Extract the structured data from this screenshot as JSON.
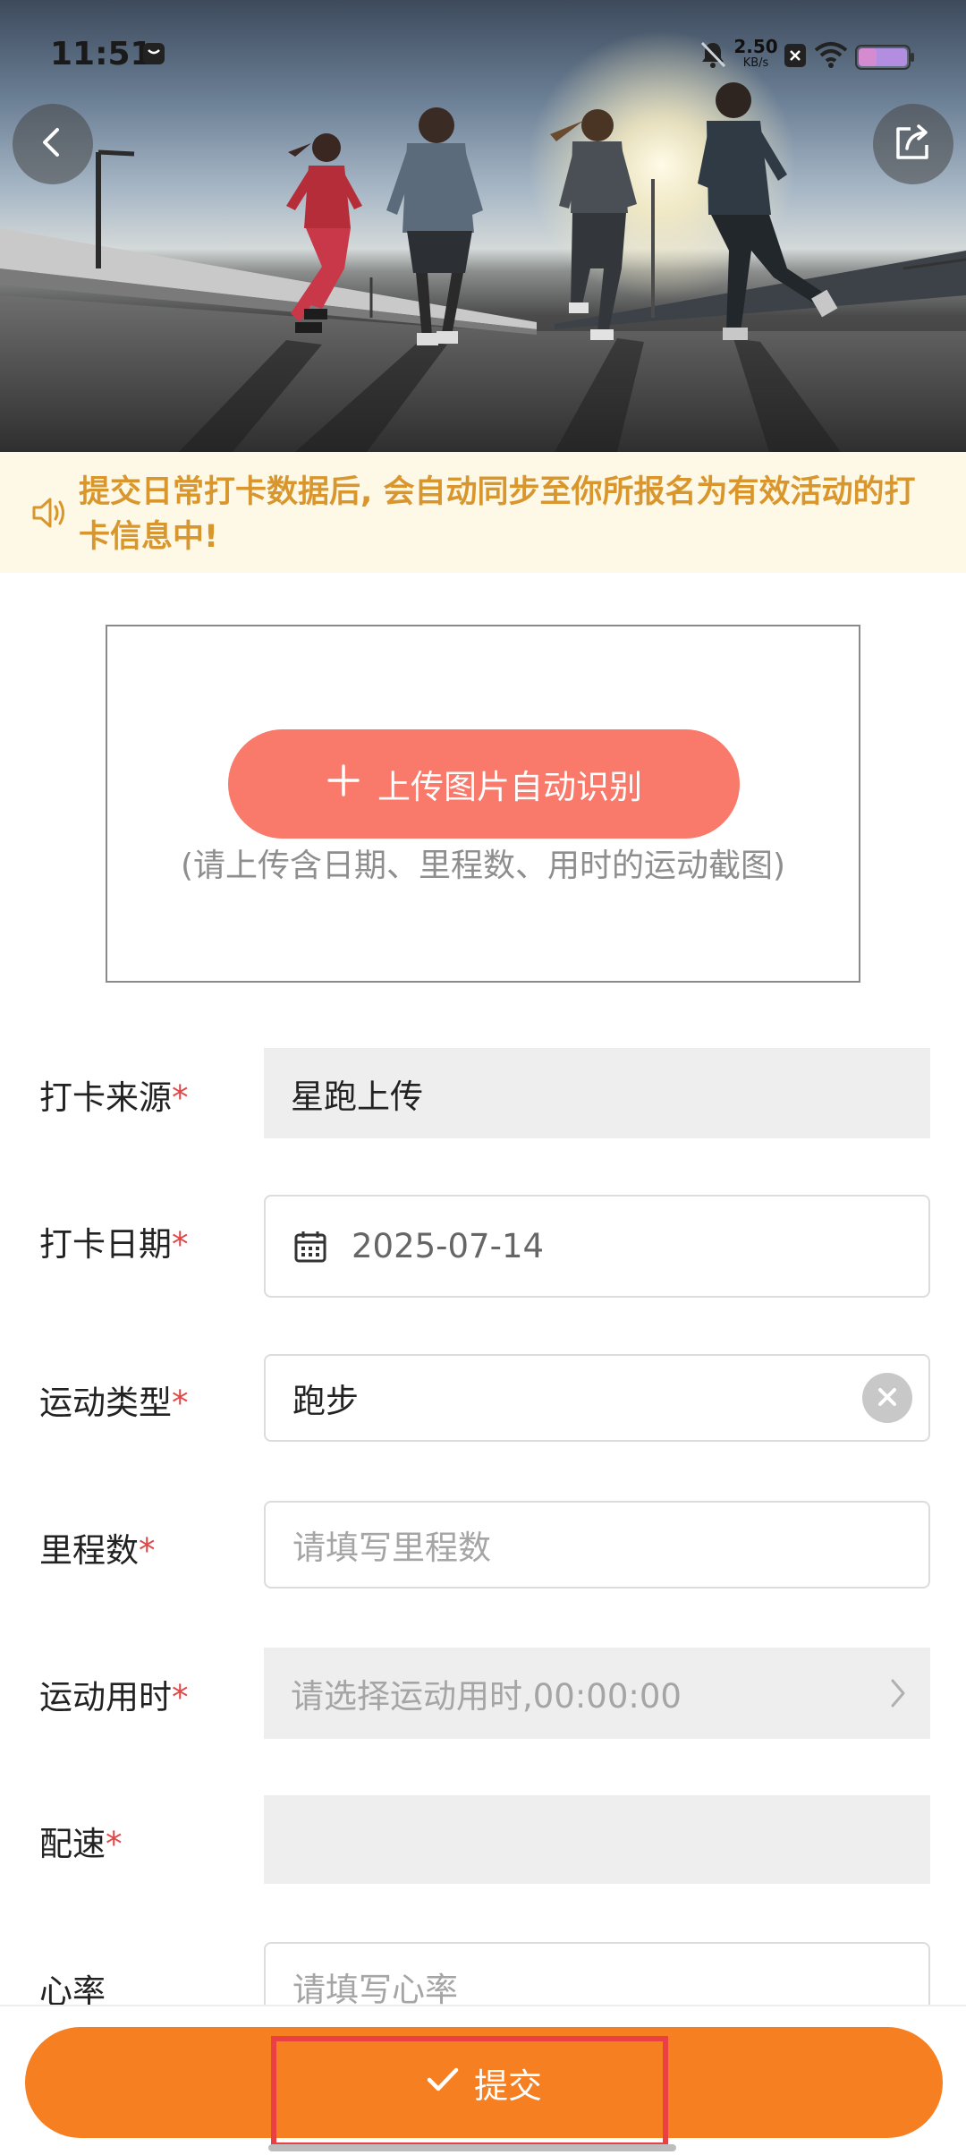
{
  "status_bar": {
    "time": "11:51",
    "net_speed_value": "2.50",
    "net_speed_unit": "KB/s"
  },
  "header": {
    "back_icon": "chevron-left-icon",
    "share_icon": "share-icon",
    "banner_image": "runners-on-road-photo"
  },
  "notice": {
    "icon": "speaker-icon",
    "text": "提交日常打卡数据后, 会自动同步至你所报名为有效活动的打卡信息中!"
  },
  "upload": {
    "button_label": "上传图片自动识别",
    "hint": "(请上传含日期、里程数、用时的运动截图)"
  },
  "form": {
    "required_mark": "*",
    "source": {
      "label": "打卡来源",
      "value": "星跑上传"
    },
    "date": {
      "label": "打卡日期",
      "value": "2025-07-14",
      "icon": "calendar-icon"
    },
    "sport_type": {
      "label": "运动类型",
      "value": "跑步",
      "clear_icon": "clear-icon"
    },
    "distance": {
      "label": "里程数",
      "placeholder": "请填写里程数"
    },
    "duration": {
      "label": "运动用时",
      "placeholder": "请选择运动用时,00:00:00",
      "icon": "chevron-right-icon"
    },
    "pace": {
      "label": "配速",
      "value": ""
    },
    "heart_rate": {
      "label": "心率",
      "placeholder": "请填写心率"
    }
  },
  "submit": {
    "label": "提交",
    "icon": "check-icon"
  },
  "colors": {
    "accent": "#f57f21",
    "upload_button": "#f9796a",
    "notice_text": "#d9962d",
    "notice_bg": "#fef8e6",
    "required": "#e04848",
    "highlight": "#ea3f43"
  }
}
